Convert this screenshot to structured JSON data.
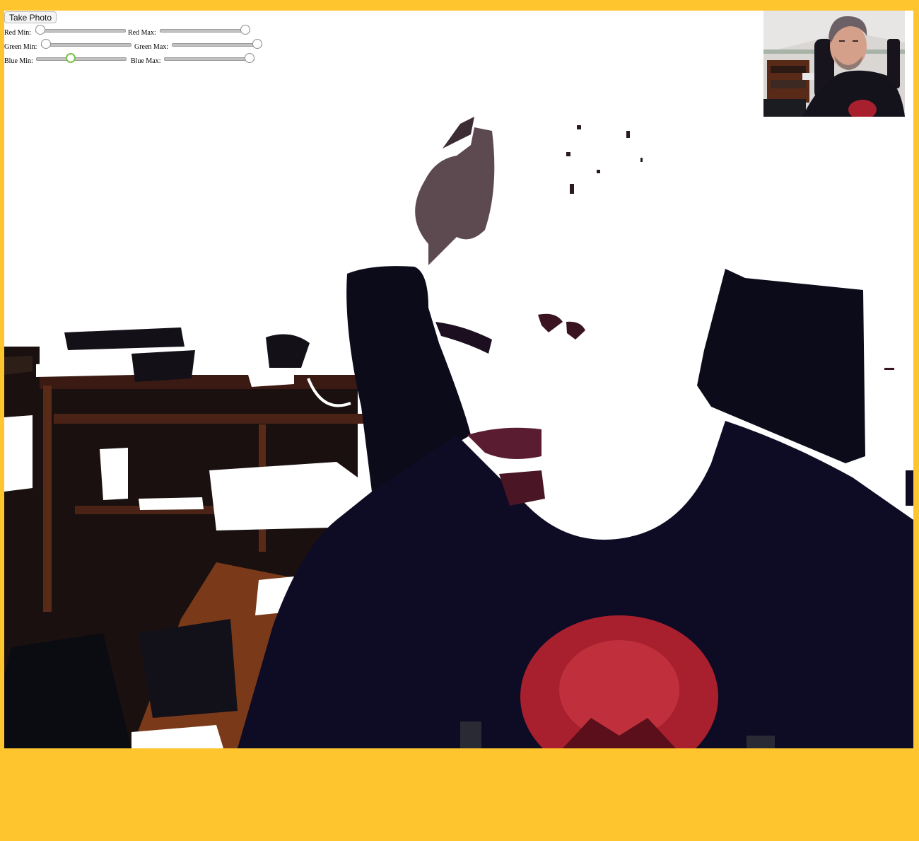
{
  "app": {
    "take_photo_label": "Take Photo"
  },
  "sliders": [
    {
      "id": "red-min",
      "label": "Red Min:",
      "value": 0,
      "min": 0,
      "max": 255
    },
    {
      "id": "red-max",
      "label": "Red Max:",
      "value": 255,
      "min": 0,
      "max": 255
    },
    {
      "id": "green-min",
      "label": "Green Min:",
      "value": 0,
      "min": 0,
      "max": 255
    },
    {
      "id": "green-max",
      "label": "Green Max:",
      "value": 255,
      "min": 0,
      "max": 255
    },
    {
      "id": "blue-min",
      "label": "Blue Min:",
      "value": 95,
      "min": 0,
      "max": 255,
      "focused": true
    },
    {
      "id": "blue-max",
      "label": "Blue Max:",
      "value": 255,
      "min": 0,
      "max": 255
    }
  ],
  "colors": {
    "page_background": "#FEC52E",
    "canvas_background": "#FFFFFF",
    "focus_ring": "#7CC24A",
    "shirt": "#0E0B24",
    "shirt_logo": "#A8202E",
    "desk": "#5A2A18"
  }
}
